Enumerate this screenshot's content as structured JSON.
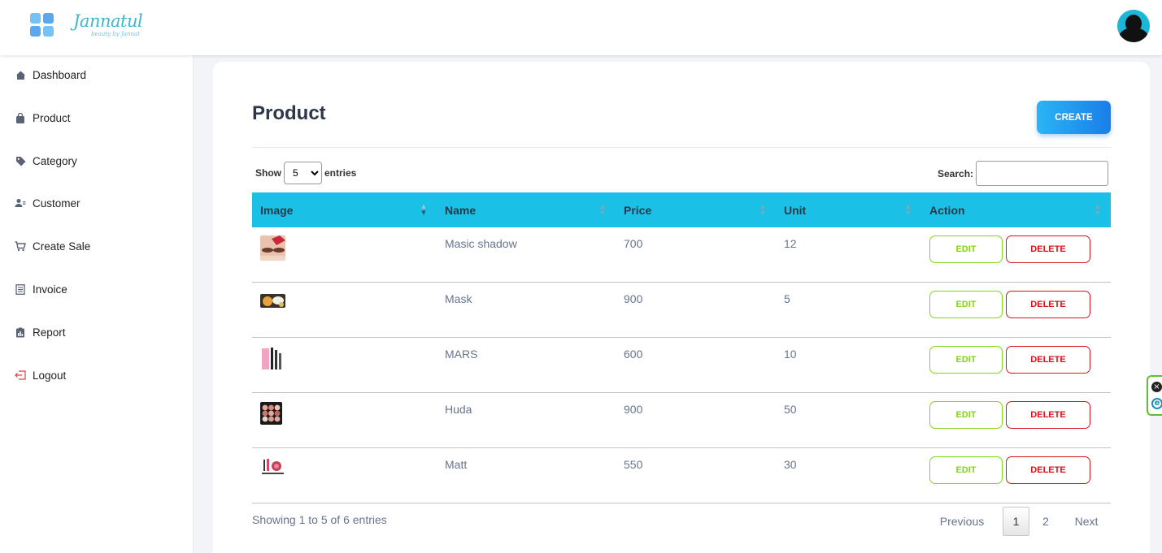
{
  "header": {
    "brand": "Jannatul",
    "tagline": "beauty by Jannat",
    "avatar_icon": "user-avatar-icon"
  },
  "sidebar": {
    "items": [
      {
        "label": "Dashboard",
        "icon": "home-icon"
      },
      {
        "label": "Product",
        "icon": "shopping-bag-icon"
      },
      {
        "label": "Category",
        "icon": "tag-icon"
      },
      {
        "label": "Customer",
        "icon": "users-icon"
      },
      {
        "label": "Create Sale",
        "icon": "cart-icon"
      },
      {
        "label": "Invoice",
        "icon": "document-icon"
      },
      {
        "label": "Report",
        "icon": "report-icon"
      },
      {
        "label": "Logout",
        "icon": "logout-icon"
      }
    ]
  },
  "main": {
    "title": "Product",
    "create_label": "CREATE",
    "show_label": "Show",
    "entries_label": "entries",
    "entries_value": "5",
    "search_label": "Search:",
    "search_value": "",
    "columns": [
      "Image",
      "Name",
      "Price",
      "Unit",
      "Action"
    ],
    "rows": [
      {
        "name": "Masic shadow",
        "price": "700",
        "unit": "12",
        "image": "eye-makeup-thumbnail"
      },
      {
        "name": "Mask",
        "price": "900",
        "unit": "5",
        "image": "mask-products-thumbnail"
      },
      {
        "name": "MARS",
        "price": "600",
        "unit": "10",
        "image": "mascara-thumbnail"
      },
      {
        "name": "Huda",
        "price": "900",
        "unit": "50",
        "image": "eyeshadow-palette-thumbnail"
      },
      {
        "name": "Matt",
        "price": "550",
        "unit": "30",
        "image": "makeup-kit-thumbnail"
      }
    ],
    "edit_label": "EDIT",
    "delete_label": "DELETE",
    "info": "Showing 1 to 5 of 6 entries",
    "pagination": {
      "previous": "Previous",
      "pages": [
        "1",
        "2"
      ],
      "next": "Next",
      "current": "1"
    }
  },
  "colors": {
    "accent": "#1ac0e6",
    "edit": "#82d616",
    "delete": "#d7131e",
    "create_start": "#2bb4f5",
    "create_end": "#1a7ee9"
  }
}
